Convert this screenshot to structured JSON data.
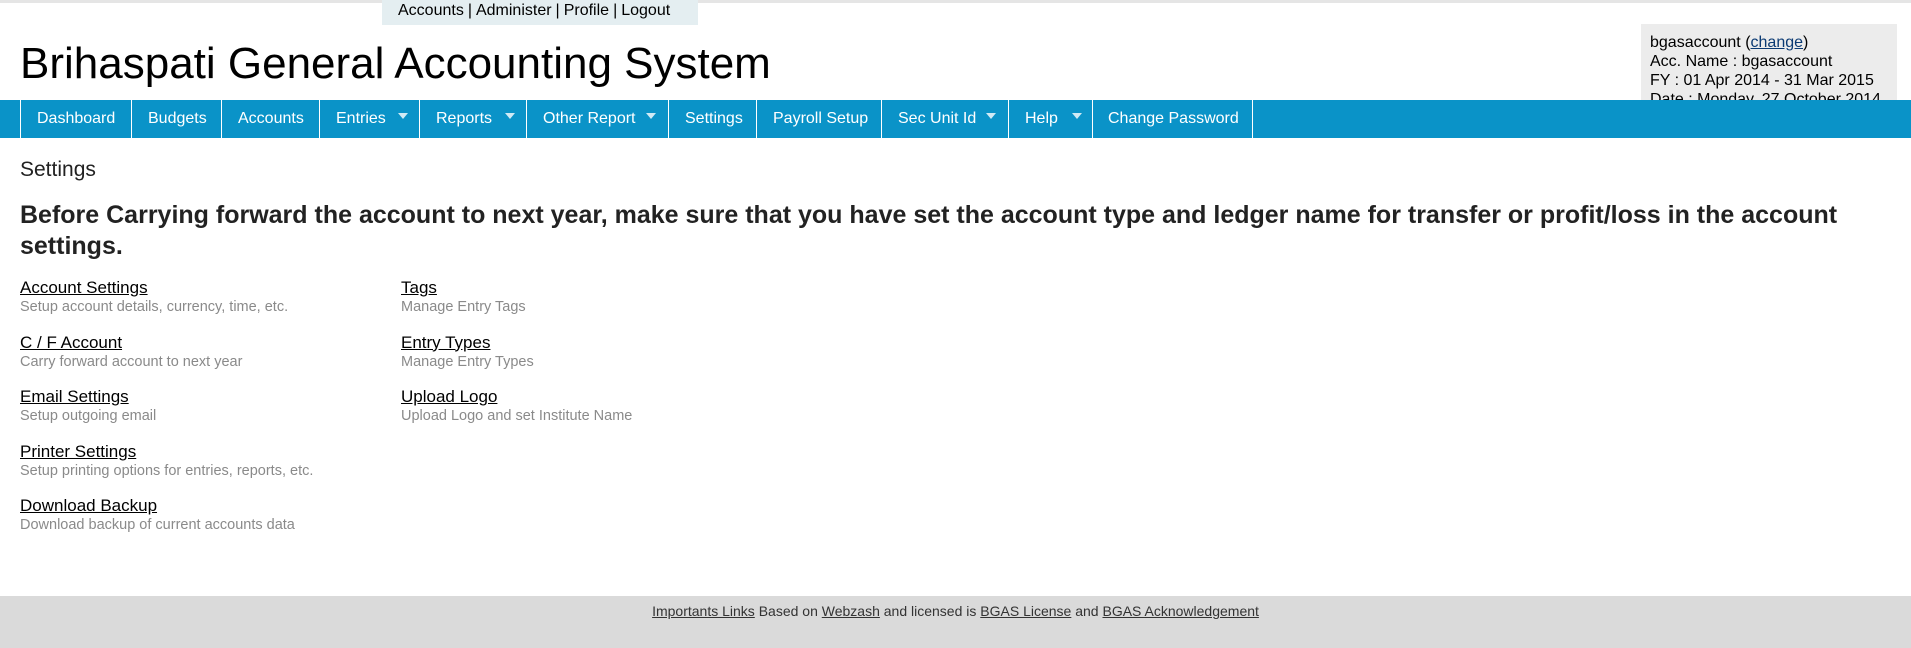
{
  "top_links": {
    "accounts": "Accounts",
    "administer": "Administer",
    "profile": "Profile",
    "logout": "Logout",
    "separator": "|"
  },
  "app_title": "Brihaspati General Accounting System",
  "user_box": {
    "username": "bgasaccount",
    "change_open": "(",
    "change_label": "change",
    "change_close": ")",
    "acc_name": "Acc. Name : bgasaccount",
    "fy": "FY : 01 Apr 2014 - 31 Mar 2015",
    "date": "Date : Monday, 27 October 2014"
  },
  "nav": {
    "items": [
      {
        "label": "Dashboard",
        "dropdown": false
      },
      {
        "label": "Budgets",
        "dropdown": false
      },
      {
        "label": "Accounts",
        "dropdown": false
      },
      {
        "label": "Entries",
        "dropdown": true
      },
      {
        "label": "Reports",
        "dropdown": true
      },
      {
        "label": "Other Report",
        "dropdown": true
      },
      {
        "label": "Settings",
        "dropdown": false
      },
      {
        "label": "Payroll Setup",
        "dropdown": false
      },
      {
        "label": "Sec Unit Id",
        "dropdown": true
      },
      {
        "label": "Help",
        "dropdown": true
      },
      {
        "label": "Change Password",
        "dropdown": false
      }
    ]
  },
  "page": {
    "heading": "Settings",
    "warning": "Before Carrying forward the account to next year, make sure that you have set the account type and ledger name for transfer or profit/loss in the account settings."
  },
  "settings": {
    "left": [
      {
        "title": "Account Settings",
        "desc": "Setup account details, currency, time, etc."
      },
      {
        "title": "C / F Account",
        "desc": "Carry forward account to next year"
      },
      {
        "title": "Email Settings",
        "desc": "Setup outgoing email"
      },
      {
        "title": "Printer Settings",
        "desc": "Setup printing options for entries, reports, etc."
      },
      {
        "title": "Download Backup",
        "desc": "Download backup of current accounts data"
      }
    ],
    "right": [
      {
        "title": "Tags",
        "desc": "Manage Entry Tags"
      },
      {
        "title": "Entry Types",
        "desc": "Manage Entry Types"
      },
      {
        "title": "Upload Logo",
        "desc": "Upload Logo and set Institute Name"
      }
    ]
  },
  "footer": {
    "important_links": "Importants Links",
    "based_on": "Based on",
    "webzash": "Webzash",
    "licensed": "and licensed is",
    "bgas_license": "BGAS License",
    "and": "and",
    "bgas_ack": "BGAS Acknowledgement"
  },
  "colors": {
    "navbar": "#0a93c8",
    "top_links_bg": "#e4eef1",
    "user_box_bg": "#ececec",
    "footer_bg": "#dadada"
  }
}
